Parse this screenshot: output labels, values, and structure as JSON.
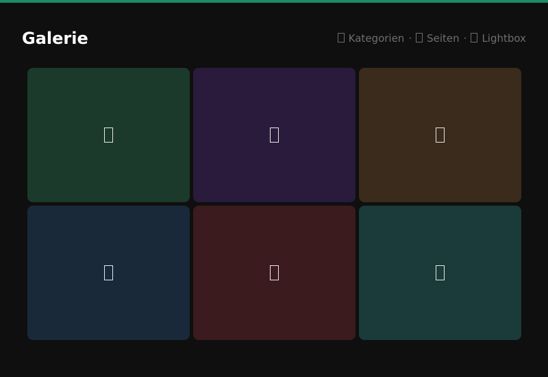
{
  "header": {
    "title": "Galerie",
    "meta": [
      {
        "label": "Kategorien",
        "icon": "category-icon"
      },
      {
        "label": "Seiten",
        "icon": "pages-icon"
      },
      {
        "label": "Lightbox",
        "icon": "lightbox-icon"
      }
    ],
    "separator": "·"
  },
  "colors": {
    "accent": "#1a8f63",
    "background": "#0f0f0f"
  },
  "tiles": [
    {
      "color": "#1b3a2b",
      "icon": "image-icon"
    },
    {
      "color": "#2a1b3c",
      "icon": "image-icon"
    },
    {
      "color": "#3b2b1c",
      "icon": "image-icon"
    },
    {
      "color": "#1a293a",
      "icon": "image-icon"
    },
    {
      "color": "#3b1b1e",
      "icon": "image-icon"
    },
    {
      "color": "#1b3a3a",
      "icon": "image-icon"
    }
  ]
}
